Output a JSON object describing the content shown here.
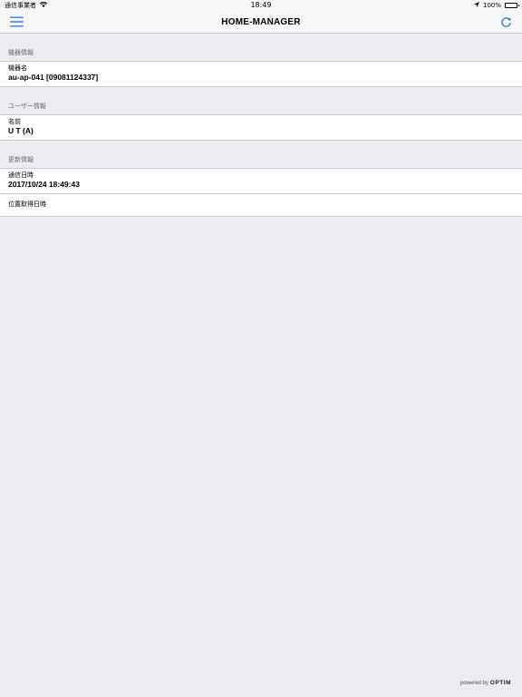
{
  "status_bar": {
    "carrier": "通信事業者",
    "time": "18:49",
    "battery": "100%"
  },
  "nav": {
    "title": "HOME-MANAGER",
    "menu_icon": "hamburger-menu-icon",
    "refresh_icon": "refresh-icon"
  },
  "sections": {
    "device": {
      "header": "機器情報",
      "name_label": "機器名",
      "name_value": "au-ap-041 [09081124337]"
    },
    "user": {
      "header": "ユーザー情報",
      "name_label": "名前",
      "name_value": "U T (A)"
    },
    "update": {
      "header": "更新情報",
      "comm_label": "通信日時",
      "comm_value": "2017/10/24 18:49:43",
      "location_label": "位置取得日時"
    }
  },
  "footer": {
    "powered_by": "powered by",
    "brand": "OPTIM"
  },
  "colors": {
    "accent": "#3478f6",
    "background": "#ebebf1",
    "separator": "#c8c7cc"
  }
}
